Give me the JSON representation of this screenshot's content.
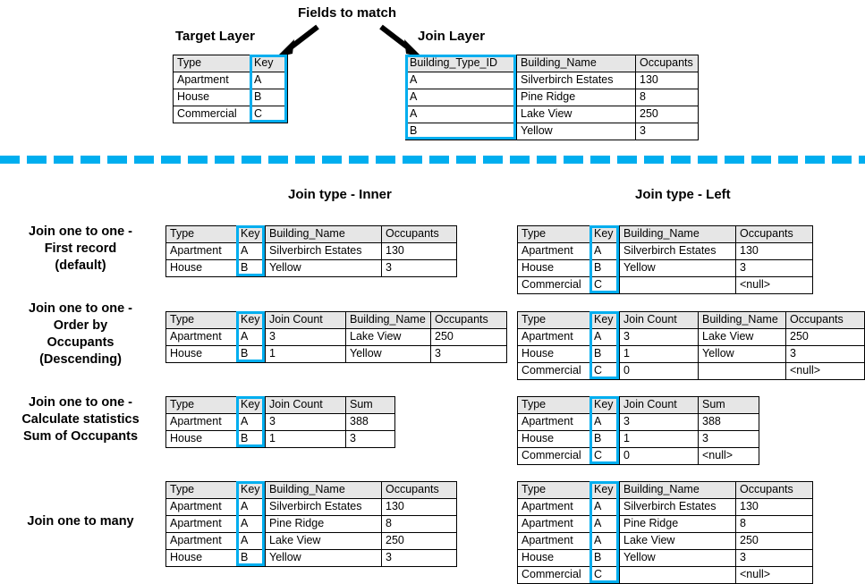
{
  "annotations": {
    "fields_to_match": "Fields to match",
    "target_layer": "Target Layer",
    "join_layer": "Join Layer"
  },
  "colors": {
    "key_highlight": "#00AEEF",
    "divider": "#00AEEF",
    "header_fill": "#e6e6e6",
    "border": "#000000",
    "text": "#000000"
  },
  "section_titles": {
    "inner": "Join type - Inner",
    "left": "Join type - Left"
  },
  "row_labels": {
    "first_record": "Join one to one -\nFirst record\n(default)",
    "first_record_lines": [
      "Join one to one -",
      "First record",
      "(default)"
    ],
    "order_by": "Join one to one -\nOrder by Occupants (Descending)",
    "order_by_lines": [
      "Join one to one -",
      "Order by",
      "Occupants",
      "(Descending)"
    ],
    "statistics_lines": [
      "Join one to one -",
      "Calculate statistics",
      "Sum of Occupants"
    ],
    "one_to_many_lines": [
      "Join one to many"
    ]
  },
  "source_tables": {
    "target": {
      "name": "Target Layer",
      "headers": [
        "Type",
        "Key"
      ],
      "key_column_index": 1,
      "rows": [
        [
          "Apartment",
          "A"
        ],
        [
          "House",
          "B"
        ],
        [
          "Commercial",
          "C"
        ]
      ]
    },
    "join": {
      "name": "Join Layer",
      "headers": [
        "Building_Type_ID",
        "Building_Name",
        "Occupants"
      ],
      "key_column_index": 0,
      "rows": [
        [
          "A",
          "Silverbirch Estates",
          "130"
        ],
        [
          "A",
          "Pine Ridge",
          "8"
        ],
        [
          "A",
          "Lake View",
          "250"
        ],
        [
          "B",
          "Yellow",
          "3"
        ]
      ]
    }
  },
  "results": [
    {
      "id": "first-record",
      "inner": {
        "headers": [
          "Type",
          "Key",
          "Building_Name",
          "Occupants"
        ],
        "key_column_index": 1,
        "rows": [
          [
            "Apartment",
            "A",
            "Silverbirch Estates",
            "130"
          ],
          [
            "House",
            "B",
            "Yellow",
            "3"
          ]
        ]
      },
      "left": {
        "headers": [
          "Type",
          "Key",
          "Building_Name",
          "Occupants"
        ],
        "key_column_index": 1,
        "rows": [
          [
            "Apartment",
            "A",
            "Silverbirch Estates",
            "130"
          ],
          [
            "House",
            "B",
            "Yellow",
            "3"
          ],
          [
            "Commercial",
            "C",
            "",
            "<null>"
          ]
        ]
      }
    },
    {
      "id": "order-by",
      "inner": {
        "headers": [
          "Type",
          "Key",
          "Join Count",
          "Building_Name",
          "Occupants"
        ],
        "key_column_index": 1,
        "rows": [
          [
            "Apartment",
            "A",
            "3",
            "Lake View",
            "250"
          ],
          [
            "House",
            "B",
            "1",
            "Yellow",
            "3"
          ]
        ]
      },
      "left": {
        "headers": [
          "Type",
          "Key",
          "Join Count",
          "Building_Name",
          "Occupants"
        ],
        "key_column_index": 1,
        "rows": [
          [
            "Apartment",
            "A",
            "3",
            "Lake View",
            "250"
          ],
          [
            "House",
            "B",
            "1",
            "Yellow",
            "3"
          ],
          [
            "Commercial",
            "C",
            "0",
            "",
            "<null>"
          ]
        ]
      }
    },
    {
      "id": "statistics",
      "inner": {
        "headers": [
          "Type",
          "Key",
          "Join Count",
          "Sum"
        ],
        "key_column_index": 1,
        "rows": [
          [
            "Apartment",
            "A",
            "3",
            "388"
          ],
          [
            "House",
            "B",
            "1",
            "3"
          ]
        ]
      },
      "left": {
        "headers": [
          "Type",
          "Key",
          "Join Count",
          "Sum"
        ],
        "key_column_index": 1,
        "rows": [
          [
            "Apartment",
            "A",
            "3",
            "388"
          ],
          [
            "House",
            "B",
            "1",
            "3"
          ],
          [
            "Commercial",
            "C",
            "0",
            "<null>"
          ]
        ]
      }
    },
    {
      "id": "one-to-many",
      "inner": {
        "headers": [
          "Type",
          "Key",
          "Building_Name",
          "Occupants"
        ],
        "key_column_index": 1,
        "rows": [
          [
            "Apartment",
            "A",
            "Silverbirch Estates",
            "130"
          ],
          [
            "Apartment",
            "A",
            "Pine Ridge",
            "8"
          ],
          [
            "Apartment",
            "A",
            "Lake View",
            "250"
          ],
          [
            "House",
            "B",
            "Yellow",
            "3"
          ]
        ]
      },
      "left": {
        "headers": [
          "Type",
          "Key",
          "Building_Name",
          "Occupants"
        ],
        "key_column_index": 1,
        "rows": [
          [
            "Apartment",
            "A",
            "Silverbirch Estates",
            "130"
          ],
          [
            "Apartment",
            "A",
            "Pine Ridge",
            "8"
          ],
          [
            "Apartment",
            "A",
            "Lake View",
            "250"
          ],
          [
            "House",
            "B",
            "Yellow",
            "3"
          ],
          [
            "Commercial",
            "C",
            "",
            "<null>"
          ]
        ]
      }
    }
  ]
}
